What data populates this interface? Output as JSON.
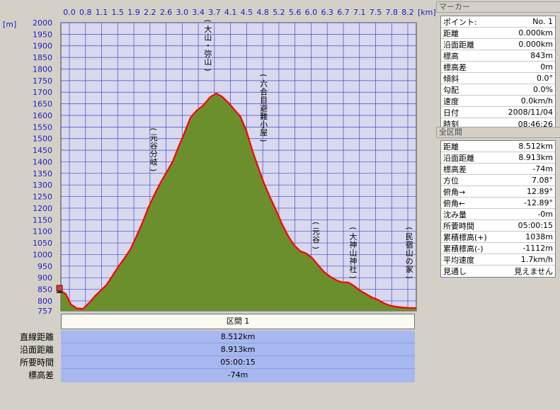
{
  "chart_data": {
    "type": "area",
    "x_unit_label": "[km]",
    "y_unit_label": "[m]",
    "x_ticks": [
      0.0,
      0.8,
      1.1,
      1.5,
      1.9,
      2.2,
      2.6,
      3.0,
      3.4,
      3.7,
      4.1,
      4.5,
      4.8,
      5.2,
      5.6,
      6.0,
      6.3,
      6.7,
      7.1,
      7.5,
      7.8,
      8.2
    ],
    "y_ticks": [
      757,
      800,
      850,
      900,
      950,
      1000,
      1050,
      1100,
      1150,
      1200,
      1250,
      1300,
      1350,
      1400,
      1450,
      1500,
      1550,
      1600,
      1650,
      1700,
      1750,
      1800,
      1850,
      1900,
      1950,
      2000
    ],
    "xlim": [
      0,
      8.913
    ],
    "ylim": [
      757,
      2000
    ],
    "series": [
      {
        "x": [
          0.0,
          0.12,
          0.25,
          0.4,
          0.55,
          0.7,
          0.85,
          1.0,
          1.15,
          1.3,
          1.45,
          1.6,
          1.75,
          1.9,
          2.05,
          2.2,
          2.35,
          2.5,
          2.65,
          2.8,
          2.95,
          3.1,
          3.25,
          3.4,
          3.55,
          3.65,
          3.75,
          3.9,
          4.05,
          4.2,
          4.35,
          4.5,
          4.65,
          4.8,
          4.95,
          5.1,
          5.25,
          5.4,
          5.55,
          5.7,
          5.85,
          6.0,
          6.15,
          6.3,
          6.45,
          6.6,
          6.75,
          6.9,
          7.05,
          7.2,
          7.35,
          7.5,
          7.65,
          7.8,
          7.95,
          8.1,
          8.25,
          8.4,
          8.55,
          8.7,
          8.913
        ],
        "values": [
          843,
          830,
          785,
          768,
          765,
          790,
          820,
          845,
          870,
          910,
          950,
          985,
          1025,
          1080,
          1140,
          1205,
          1260,
          1310,
          1355,
          1400,
          1465,
          1525,
          1590,
          1620,
          1640,
          1660,
          1680,
          1695,
          1680,
          1655,
          1625,
          1595,
          1535,
          1450,
          1375,
          1305,
          1245,
          1190,
          1130,
          1080,
          1040,
          1015,
          1005,
          985,
          955,
          925,
          905,
          890,
          880,
          880,
          865,
          845,
          830,
          815,
          805,
          790,
          780,
          775,
          772,
          770,
          769
        ]
      }
    ],
    "annotations": [
      "(大山・弥山)",
      "(六合目避難小屋)",
      "(元谷分岐)",
      "(元谷)",
      "(大神山神社)",
      "(民宿山の家)"
    ]
  },
  "marker": {
    "title": "マーカー",
    "rows": [
      {
        "label": "ポイント:",
        "value": "No. 1"
      },
      {
        "label": "距離",
        "value": "0.000km"
      },
      {
        "label": "沿面距離",
        "value": "0.000km"
      },
      {
        "label": "標高",
        "value": "843m"
      },
      {
        "label": "標高差",
        "value": "0m"
      },
      {
        "label": "傾斜",
        "value": "0.0°"
      },
      {
        "label": "勾配",
        "value": "0.0%"
      },
      {
        "label": "速度",
        "value": "0.0km/h"
      },
      {
        "label": "日付",
        "value": "2008/11/04"
      },
      {
        "label": "時刻",
        "value": "08:46:26"
      }
    ]
  },
  "section_all": {
    "title": "全区間",
    "rows": [
      {
        "label": "距離",
        "value": "8.512km"
      },
      {
        "label": "沿面距離",
        "value": "8.913km"
      },
      {
        "label": "標高差",
        "value": "-74m"
      },
      {
        "label": "方位",
        "value": "7.08°"
      },
      {
        "label": "俯角→",
        "value": "12.89°"
      },
      {
        "label": "俯角←",
        "value": "-12.89°"
      },
      {
        "label": "沈み量",
        "value": "-0m"
      },
      {
        "label": "所要時間",
        "value": "05:00:15"
      },
      {
        "label": "累積標高(+)",
        "value": "1038m"
      },
      {
        "label": "累積標高(-)",
        "value": "-1112m"
      },
      {
        "label": "平均速度",
        "value": "1.7km/h"
      },
      {
        "label": "見通し",
        "value": "見えません"
      }
    ]
  },
  "summary": {
    "section_label": "区間 1",
    "rows": [
      {
        "label": "直線距離",
        "value": "8.512km"
      },
      {
        "label": "沿面距離",
        "value": "8.913km"
      },
      {
        "label": "所要時間",
        "value": "05:00:15"
      },
      {
        "label": "標高差",
        "value": "-74m"
      }
    ]
  },
  "colors": {
    "fill": "#6a8f2c",
    "line": "#ff0000",
    "plot_bg": "#d8d8ee",
    "grid": "#4848c8"
  }
}
